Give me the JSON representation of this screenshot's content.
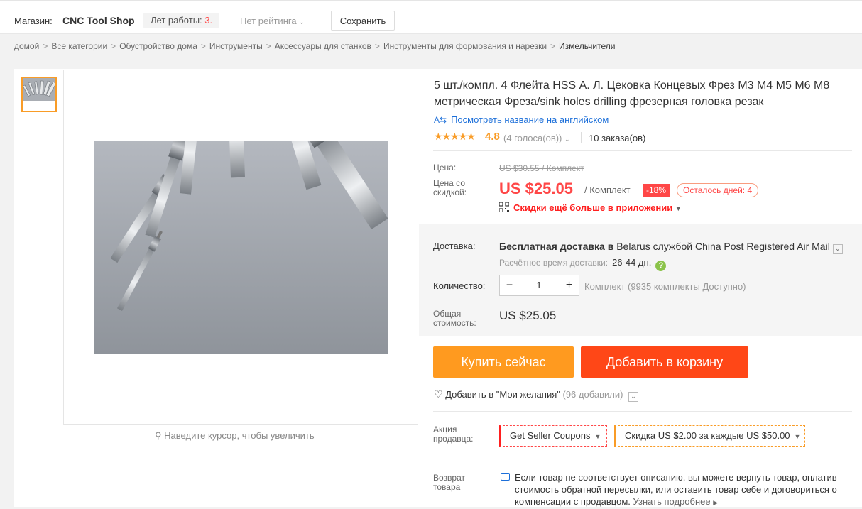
{
  "store": {
    "label": "Магазин:",
    "name": "CNC Tool Shop",
    "years_label": "Лет работы:",
    "years_value": "3",
    "years_dot": ".",
    "rating": "Нет рейтинга",
    "save": "Сохранить"
  },
  "breadcrumbs": [
    "домой",
    "Все категории",
    "Обустройство дома",
    "Инструменты",
    "Аксессуары для станков",
    "Инструменты для формования и нарезки",
    "Измельчители"
  ],
  "gallery": {
    "zoom_hint": "Наведите курсор, чтобы увеличить"
  },
  "product": {
    "title": "5 шт./компл. 4 Флейта HSS А. Л. Цековка Концевых Фрез М3 М4 М5 М6 М8 метрическая Фреза/sink holes drilling фрезерная головка резак",
    "translate": "Посмотреть название на английском",
    "stars": "★★★★★",
    "score": "4.8",
    "votes": "(4 голоса(ов))",
    "orders": "10 заказа(ов)"
  },
  "price": {
    "label": "Цена:",
    "old": "US $30.55 / Комплект",
    "discount_label_1": "Цена со",
    "discount_label_2": "скидкой:",
    "current": "US $25.05",
    "unit": "/ Комплект",
    "discount": "-18%",
    "days_left": "Осталось дней: 4",
    "app_deal": "Скидки ещё больше в приложении"
  },
  "shipping": {
    "label": "Доставка:",
    "free": "Бесплатная доставка в",
    "country": "Belarus",
    "via": "службой",
    "carrier": "China Post Registered Air Mail",
    "est_label": "Расчётное время доставки:",
    "est_days": "26-44 дн."
  },
  "quantity": {
    "label": "Количество:",
    "value": "1",
    "note": "Комплект (9935 комплекты Доступно)"
  },
  "total": {
    "label_1": "Общая",
    "label_2": "стоимость:",
    "value": "US $25.05"
  },
  "actions": {
    "buy": "Купить сейчас",
    "cart": "Добавить в корзину",
    "wish": "Добавить в \"Мои желания\"",
    "wish_count": "(96 добавили)"
  },
  "promo": {
    "label_1": "Акция",
    "label_2": "продавца:",
    "coupon": "Get Seller Coupons",
    "discount_pre": "Скидка",
    "discount_amount": "US $2.00",
    "discount_mid": "за каждые",
    "discount_threshold": "US $50.00"
  },
  "returns": {
    "label_1": "Возврат",
    "label_2": "товара",
    "text": "Если товар не соответствует описанию, вы можете вернуть товар, оплатив стоимость обратной пересылки, или оставить товар себе и договориться о компенсации с продавцом.",
    "more": "Узнать подробнее"
  },
  "colors": {
    "accent": "#ff4747",
    "buy": "#ff9a1f",
    "cart": "#ff4717",
    "star": "#f99c27",
    "link": "#1c6fd9"
  }
}
